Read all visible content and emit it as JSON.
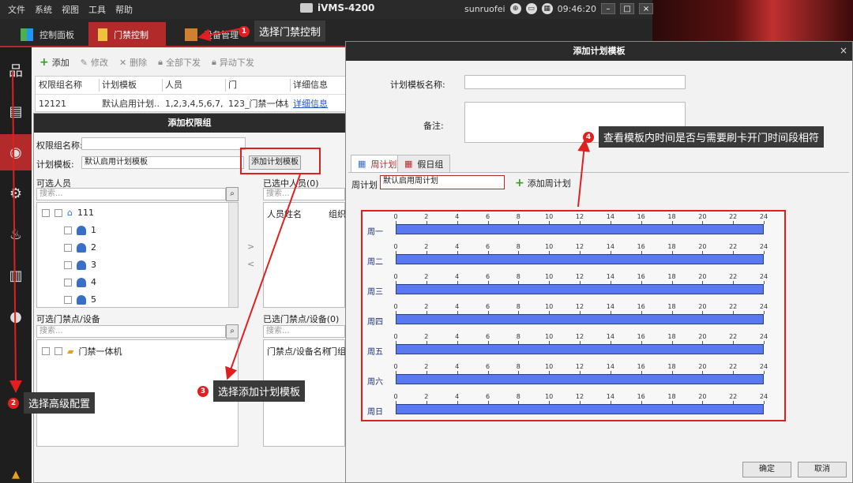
{
  "menubar": {
    "items": [
      "文件",
      "系统",
      "视图",
      "工具",
      "帮助"
    ],
    "app_name": "iVMS-4200",
    "user": "sunruofei",
    "time": "09:46:20"
  },
  "main_tabs": [
    {
      "label": "控制面板"
    },
    {
      "label": "门禁控制"
    },
    {
      "label": "设备管理"
    }
  ],
  "toolbar": {
    "add": "添加",
    "edit": "修改",
    "delete": "删除",
    "all_send": "全部下发",
    "async_send": "异动下发"
  },
  "grid": {
    "headers": [
      "权限组名称",
      "计划模板",
      "人员",
      "门",
      "详细信息"
    ],
    "row": [
      "12121",
      "默认启用计划...",
      "1,2,3,4,5,6,7,8,...",
      "123_门禁一体机",
      "详细信息"
    ]
  },
  "perm_dialog": {
    "title": "添加权限组",
    "name_label": "权限组名称:",
    "template_label": "计划模板:",
    "template_value": "默认启用计划模板",
    "add_template_button": "添加计划模板",
    "available_persons": "可选人员",
    "selected_persons": "已选中人员(0)",
    "search_placeholder": "搜索...",
    "person_name_col": "人员姓名",
    "org_col": "组织",
    "tree_root": "111",
    "tree_items": [
      "1",
      "2",
      "3",
      "4",
      "5"
    ],
    "available_doors": "可选门禁点/设备",
    "selected_doors": "已选门禁点/设备(0)",
    "door_col": "门禁点/设备名称",
    "door_col2": "门组",
    "device": "门禁一体机"
  },
  "plan_dialog": {
    "title": "添加计划模板",
    "name_label": "计划模板名称:",
    "remark_label": "备注:",
    "tab_week": "周计划",
    "tab_holiday": "假日组",
    "week_plan_label": "周计划",
    "week_plan_value": "默认启用周计划",
    "add_week_plan": "添加周计划",
    "days": [
      "周一",
      "周二",
      "周三",
      "周四",
      "周五",
      "周六",
      "周日"
    ],
    "ticks": [
      "0",
      "2",
      "4",
      "6",
      "8",
      "10",
      "12",
      "14",
      "16",
      "18",
      "20",
      "22",
      "24"
    ],
    "ok": "确定",
    "cancel": "取消"
  },
  "callouts": [
    {
      "num": "1",
      "text": "选择门禁控制"
    },
    {
      "num": "2",
      "text": "选择高级配置"
    },
    {
      "num": "3",
      "text": "选择添加计划模板"
    },
    {
      "num": "4",
      "text": "查看模板内时间是否与需要刷卡开门时间段相符"
    }
  ],
  "colors": {
    "accent": "#b22a2a",
    "bar": "#5a78f0",
    "annotation": "#e02020"
  }
}
